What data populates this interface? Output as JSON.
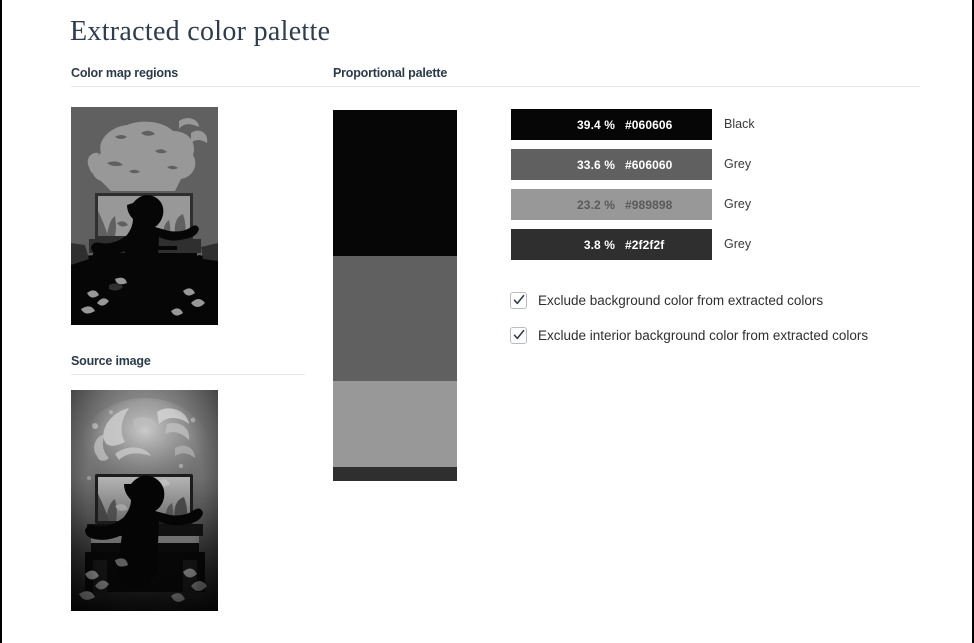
{
  "page": {
    "title": "Extracted color palette"
  },
  "sections": {
    "colormap": {
      "header": "Color map regions"
    },
    "proportional": {
      "header": "Proportional palette"
    },
    "source": {
      "header": "Source image"
    }
  },
  "proportional_palette": {
    "segments": [
      {
        "color": "#060606",
        "percent": 39.4
      },
      {
        "color": "#606060",
        "percent": 33.6
      },
      {
        "color": "#989898",
        "percent": 23.2
      },
      {
        "color": "#2f2f2f",
        "percent": 3.8
      }
    ]
  },
  "palette_rows": [
    {
      "percent_label": "39.4 %",
      "hex_label": "#060606",
      "swatch": "#060606",
      "text_color": "#ffffff",
      "name": "Black"
    },
    {
      "percent_label": "33.6 %",
      "hex_label": "#606060",
      "swatch": "#606060",
      "text_color": "#ffffff",
      "name": "Grey"
    },
    {
      "percent_label": "23.2 %",
      "hex_label": "#989898",
      "swatch": "#989898",
      "text_color": "#5a5a5a",
      "name": "Grey"
    },
    {
      "percent_label": "3.8 %",
      "hex_label": "#2f2f2f",
      "swatch": "#2f2f2f",
      "text_color": "#ffffff",
      "name": "Grey"
    }
  ],
  "options": [
    {
      "label": "Exclude background color from extracted colors",
      "checked": true
    },
    {
      "label": "Exclude interior background color from extracted colors",
      "checked": true
    }
  ],
  "images": {
    "colormap": {
      "alt": "quantized color map regions of a child at a piano with an aquarium",
      "tones": [
        "#060606",
        "#2f2f2f",
        "#606060",
        "#989898"
      ]
    },
    "source": {
      "alt": "greyscale artwork of a child reaching toward an aquarium on a piano with splashing water"
    }
  },
  "theme": {
    "title_color": "#2e3d4e",
    "header_color": "#2b3a4a",
    "divider_color": "#e4e8ec",
    "body_text_color": "#2f2f2f"
  }
}
